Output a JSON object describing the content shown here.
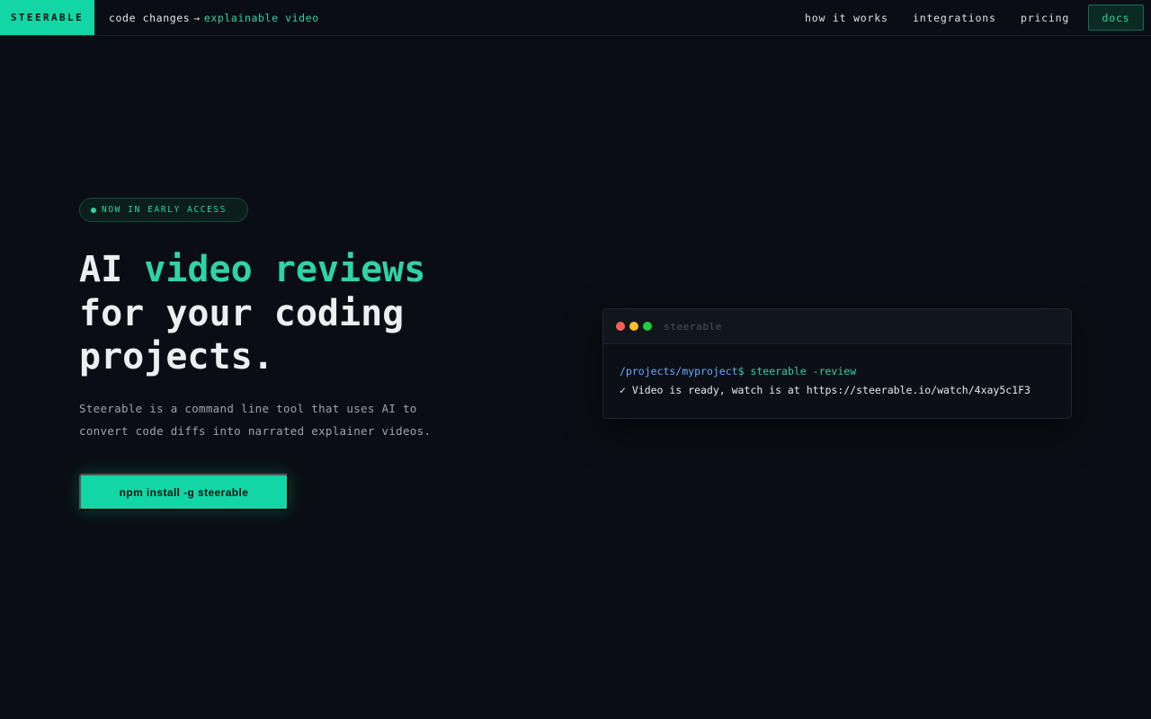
{
  "nav": {
    "brand": "STEERABLE",
    "tagline": {
      "prefix": "code changes",
      "arrow": "→",
      "accent": "explainable video"
    },
    "links": [
      {
        "label": "how it works"
      },
      {
        "label": "integrations"
      },
      {
        "label": "pricing"
      }
    ],
    "docs_label": "docs"
  },
  "hero": {
    "badge": "NOW IN EARLY ACCESS",
    "headline": {
      "part1": "AI ",
      "highlight": "video reviews",
      "part2": "for your coding",
      "part3": "projects."
    },
    "description": "Steerable is a command line tool that uses AI to convert code diffs into narrated explainer videos.",
    "cta_label": "npm install -g steerable"
  },
  "terminal": {
    "title": "steerable",
    "path": "/projects/myproject",
    "prompt": "$",
    "command": " steerable -review",
    "output": "✓ Video is ready, watch is at https://steerable.io/watch/4xay5c1F3"
  },
  "colors": {
    "accent": "#12d6a6",
    "background": "#0a0e14",
    "path": "#6ea8ff"
  }
}
